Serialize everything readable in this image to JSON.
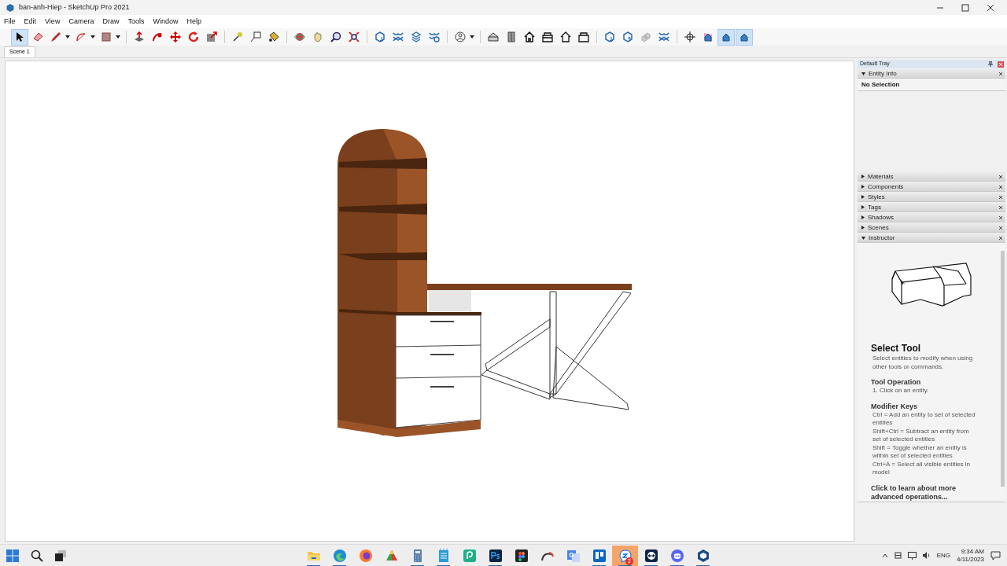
{
  "window": {
    "title": "ban-anh-Hiep - SketchUp Pro 2021"
  },
  "menu": [
    "File",
    "Edit",
    "View",
    "Camera",
    "Draw",
    "Tools",
    "Window",
    "Help"
  ],
  "toolbar": [
    {
      "selected": true
    },
    {
      "selected": false
    },
    {
      "selected": false
    },
    {
      "selected": false
    },
    {
      "selected": false
    },
    {
      "selected": false
    },
    {
      "selected": false
    },
    {
      "selected": false
    },
    {
      "selected": false
    },
    {
      "selected": false
    },
    {
      "selected": false
    },
    {
      "selected": false
    },
    {
      "selected": false
    },
    {
      "selected": false
    },
    {
      "selected": false
    },
    {
      "selected": false
    },
    {
      "selected": false
    },
    {
      "selected": false
    },
    {
      "selected": false
    },
    {
      "selected": false
    },
    {
      "selected": false
    },
    {
      "selected": false
    },
    {
      "selected": false
    },
    {
      "selected": false
    },
    {
      "selected": false
    },
    {
      "selected": false
    },
    {
      "selected": false
    },
    {
      "selected": false
    },
    {
      "selected": false
    },
    {
      "selected": false
    },
    {
      "selected": false
    },
    {
      "selected": false
    },
    {
      "selected": false
    },
    {
      "selected": false
    },
    {
      "selected": true
    },
    {
      "selected": true
    }
  ],
  "scene_tabs": [
    {
      "label": "Scene 1",
      "selected": true
    }
  ],
  "tray": {
    "title": "Default Tray",
    "panels": [
      {
        "title": "Entity Info",
        "expanded": true
      },
      {
        "title": "Materials",
        "expanded": false
      },
      {
        "title": "Components",
        "expanded": false
      },
      {
        "title": "Styles",
        "expanded": false
      },
      {
        "title": "Tags",
        "expanded": false
      },
      {
        "title": "Shadows",
        "expanded": false
      },
      {
        "title": "Scenes",
        "expanded": false
      },
      {
        "title": "Instructor",
        "expanded": true
      }
    ],
    "entity_info": "No Selection",
    "instructor": {
      "heading": "Select Tool",
      "description": "Select entities to modify when using other tools or commands.",
      "sections": [
        {
          "heading": "Tool Operation",
          "lines": [
            "1. Click on an entity."
          ]
        },
        {
          "heading": "Modifier Keys",
          "lines": [
            "Ctrl = Add an entity to set of selected entities",
            "Shift+Ctrl = Subtract an entity from set of selected entities",
            "Shift = Toggle whether an entity is within set of selected entities",
            "Ctrl+A = Select all visible entities in model"
          ]
        }
      ],
      "link": "Click to learn about more advanced operations..."
    }
  },
  "taskbar": {
    "apps": [
      {
        "running": true,
        "selected": false
      },
      {
        "running": true,
        "selected": false
      },
      {
        "running": false,
        "selected": false
      },
      {
        "running": false,
        "selected": false
      },
      {
        "running": true,
        "selected": false
      },
      {
        "running": true,
        "selected": false
      },
      {
        "running": false,
        "selected": false
      },
      {
        "running": true,
        "selected": false
      },
      {
        "running": false,
        "selected": false
      },
      {
        "running": false,
        "selected": false
      },
      {
        "running": false,
        "selected": false
      },
      {
        "running": true,
        "selected": false
      },
      {
        "running": true,
        "selected": true,
        "badge": "2"
      },
      {
        "running": true,
        "selected": false
      },
      {
        "running": true,
        "selected": false
      },
      {
        "running": true,
        "selected": false
      }
    ],
    "language": "ENG",
    "time": "9:34 AM",
    "date": "4/11/2023"
  }
}
